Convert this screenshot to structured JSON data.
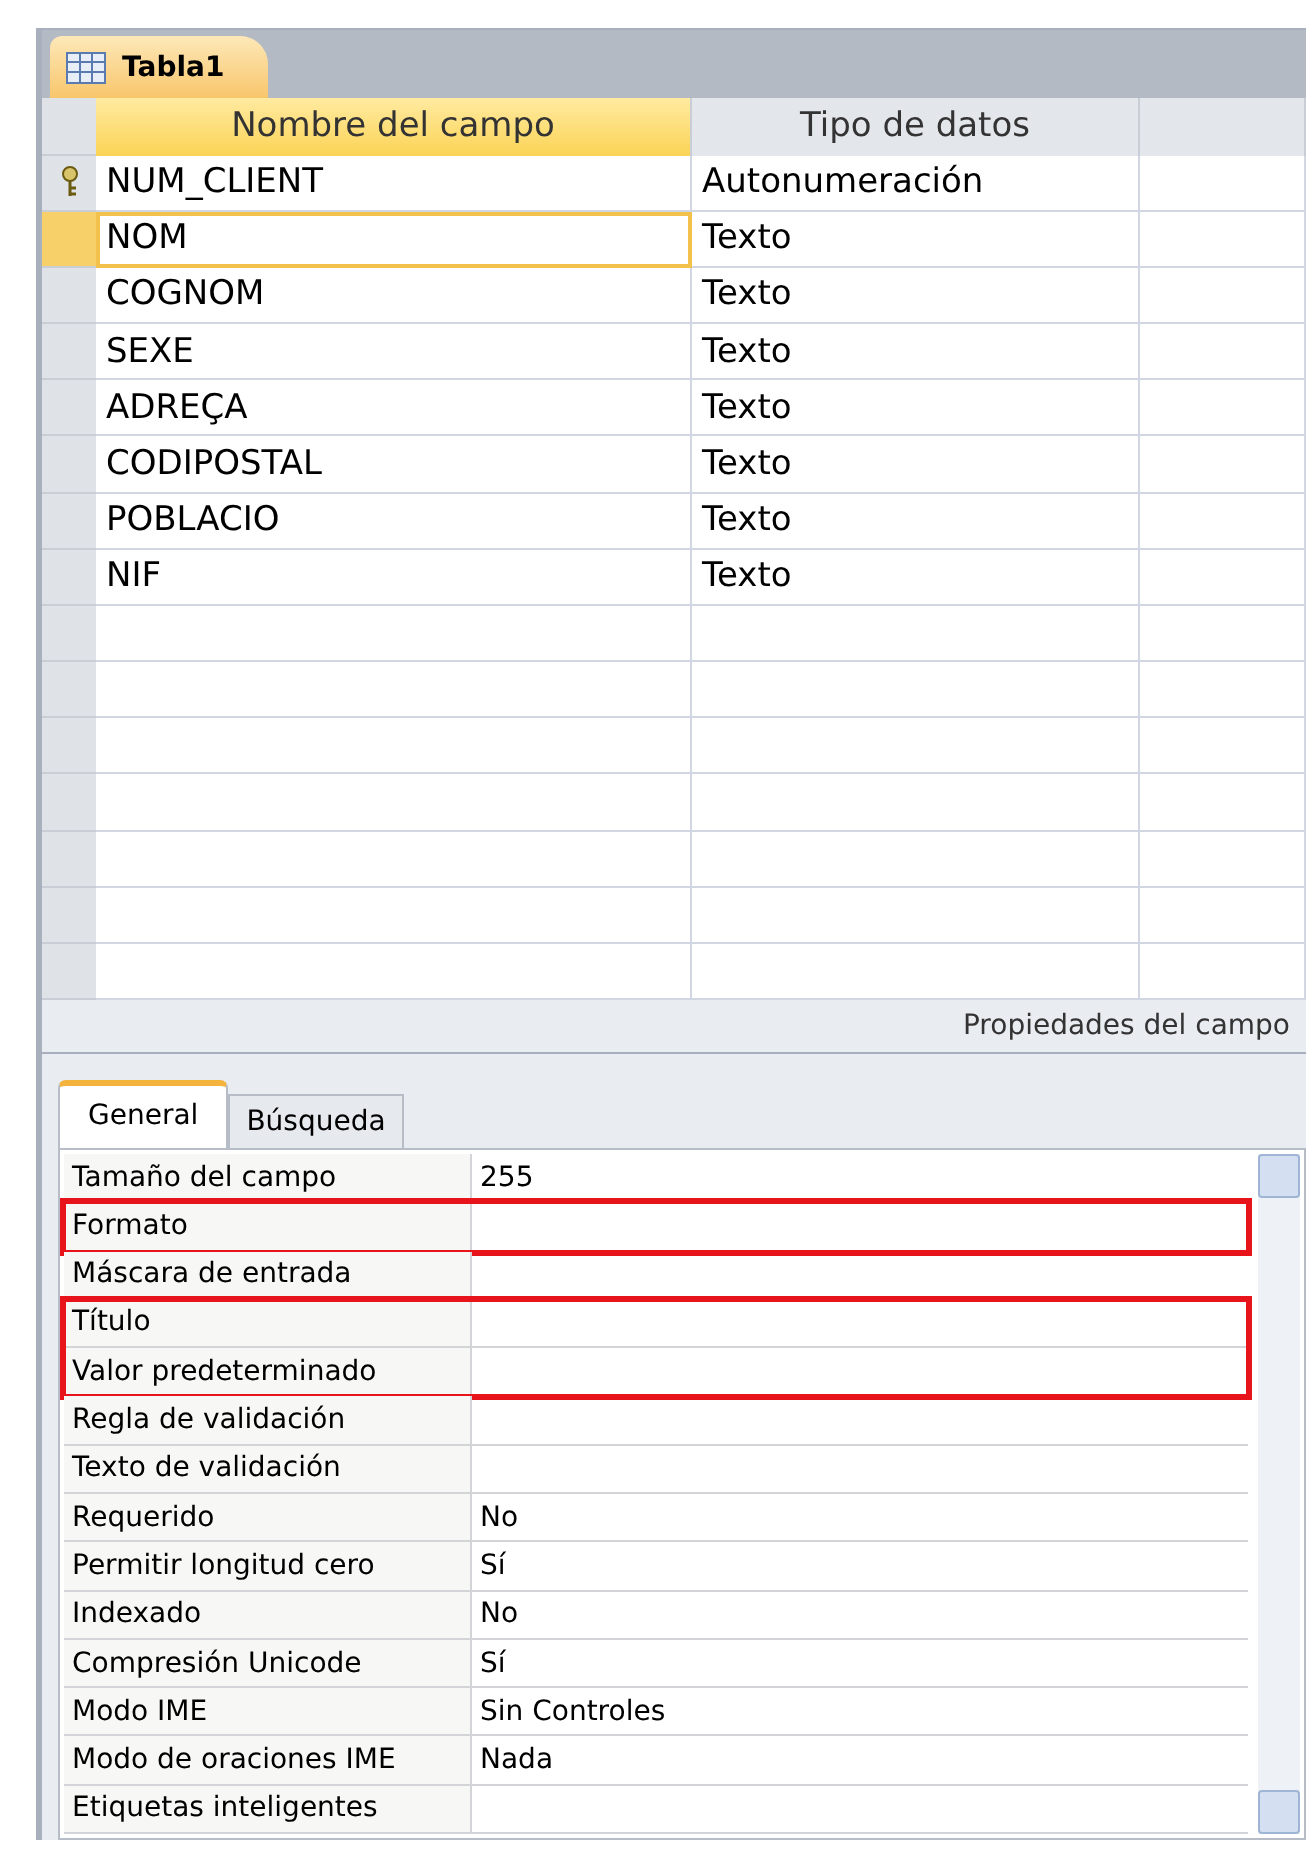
{
  "document_tab": {
    "label": "Tabla1",
    "selected": true
  },
  "columns": [
    "Nombre del campo",
    "Tipo de datos"
  ],
  "fields": [
    {
      "name": "NUM_CLIENT",
      "type": "Autonumeración",
      "primary_key": true,
      "selected": false
    },
    {
      "name": "NOM",
      "type": "Texto",
      "primary_key": false,
      "selected": true
    },
    {
      "name": "COGNOM",
      "type": "Texto",
      "primary_key": false,
      "selected": false
    },
    {
      "name": "SEXE",
      "type": "Texto",
      "primary_key": false,
      "selected": false
    },
    {
      "name": "ADREÇA",
      "type": "Texto",
      "primary_key": false,
      "selected": false
    },
    {
      "name": "CODIPOSTAL",
      "type": "Texto",
      "primary_key": false,
      "selected": false
    },
    {
      "name": "POBLACIO",
      "type": "Texto",
      "primary_key": false,
      "selected": false
    },
    {
      "name": "NIF",
      "type": "Texto",
      "primary_key": false,
      "selected": false
    }
  ],
  "properties_heading": "Propiedades del campo",
  "property_tabs": [
    {
      "label": "General",
      "selected": true
    },
    {
      "label": "Búsqueda",
      "selected": false
    }
  ],
  "properties": [
    {
      "label": "Tamaño del campo",
      "value": "255",
      "highlighted": false
    },
    {
      "label": "Formato",
      "highlighted": true
    },
    {
      "label": "Máscara de entrada",
      "highlighted": false
    },
    {
      "label": "Título",
      "highlighted": true
    },
    {
      "label": "Valor predeterminado",
      "highlighted": true
    },
    {
      "label": "Regla de validación",
      "highlighted": false
    },
    {
      "label": "Texto de validación",
      "highlighted": false
    },
    {
      "label": "Requerido",
      "value": "No",
      "highlighted": false
    },
    {
      "label": "Permitir longitud cero",
      "value": "Sí",
      "highlighted": false
    },
    {
      "label": "Indexado",
      "value": "No",
      "highlighted": false
    },
    {
      "label": "Compresión Unicode",
      "value": "Sí",
      "highlighted": false
    },
    {
      "label": "Modo IME",
      "value": "Sin Controles",
      "highlighted": false
    },
    {
      "label": "Modo de oraciones IME",
      "value": "Nada",
      "highlighted": false
    },
    {
      "label": "Etiquetas inteligentes",
      "highlighted": false
    }
  ]
}
